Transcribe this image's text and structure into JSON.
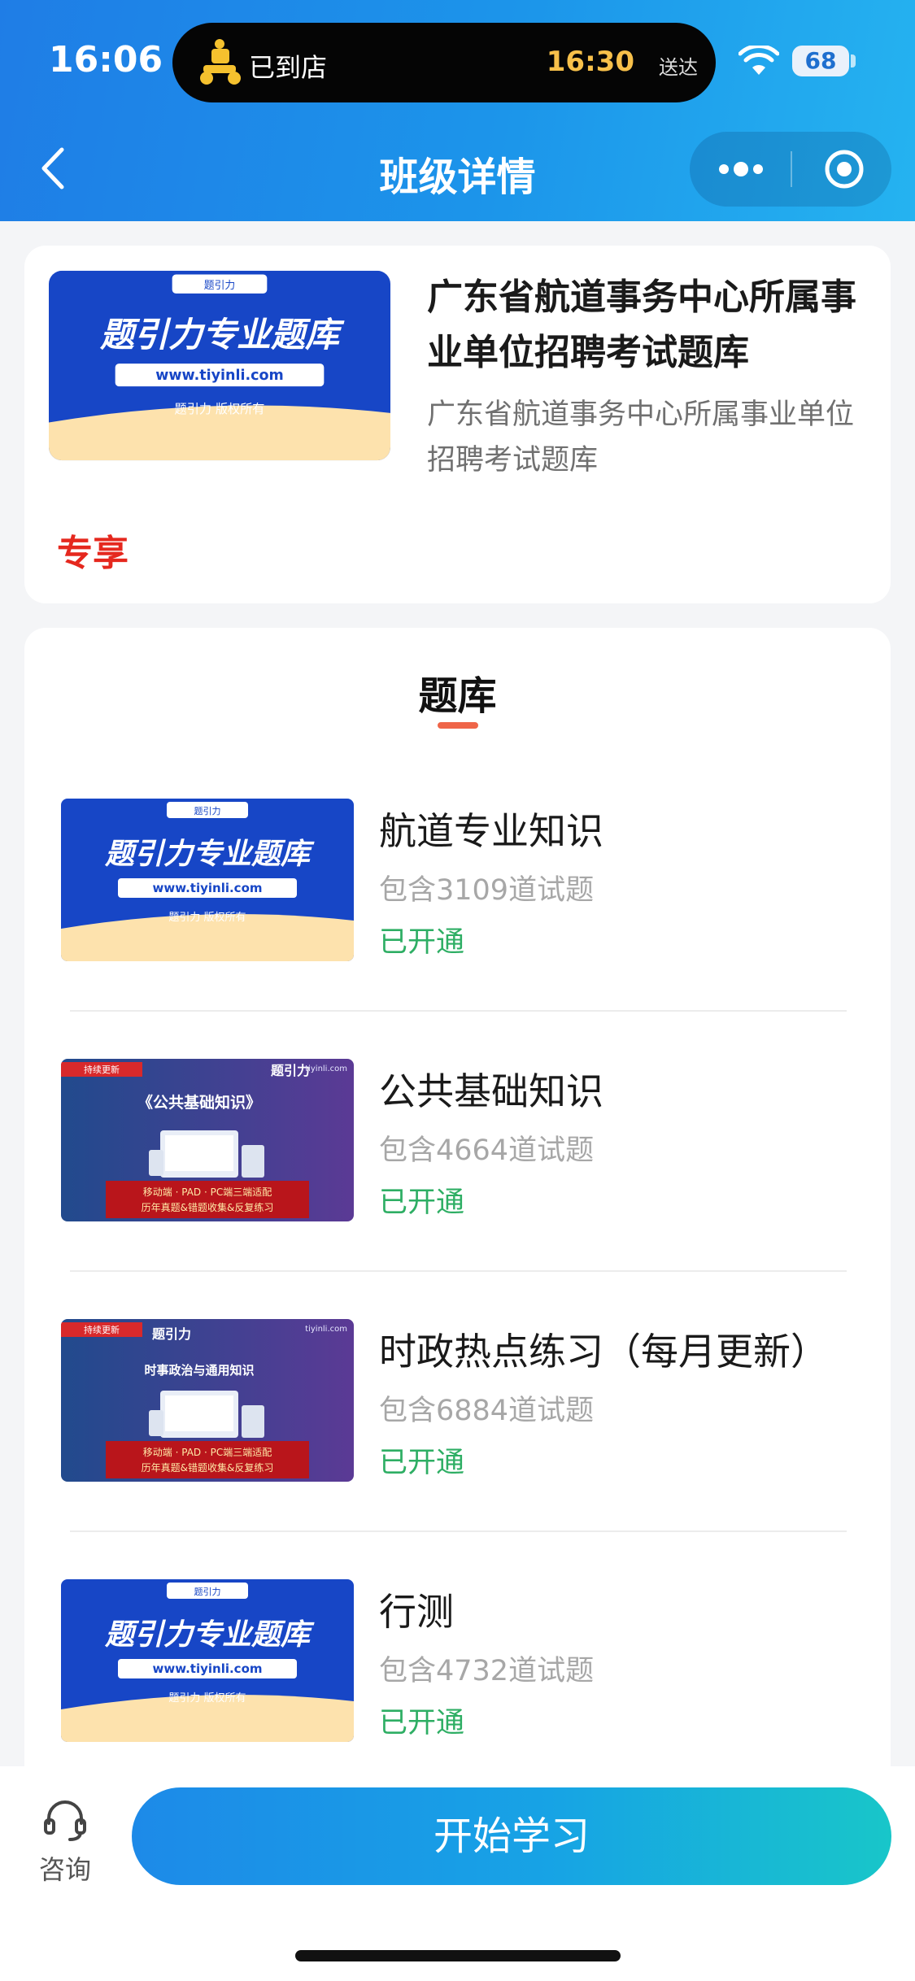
{
  "status_bar": {
    "time": "16:06",
    "live_activity": {
      "status": "已到店",
      "time": "16:30",
      "sub": "送达"
    },
    "battery": "68"
  },
  "nav": {
    "title": "班级详情"
  },
  "course": {
    "title": "广东省航道事务中心所属事业单位招聘考试题库",
    "description": "广东省航道事务中心所属事业单位招聘考试题库",
    "badge": "专享"
  },
  "section": {
    "title": "题库"
  },
  "thumbnails": {
    "brand": {
      "logo_text": "题引力",
      "headline": "题引力专业题库",
      "url": "www.tiyinli.com",
      "footer": "题引力 版权所有"
    },
    "public_basic": {
      "tag": "持续更新",
      "brand": "题引力",
      "site": "tiyinli.com",
      "headline": "《公共基础知识》",
      "line1": "移动端 · PAD · PC端三端适配",
      "line2": "历年真题&错题收集&反复练习"
    },
    "politics": {
      "tag": "持续更新",
      "brand": "题引力",
      "site": "tiyinli.com",
      "headline": "时事政治与通用知识",
      "line1": "移动端 · PAD · PC端三端适配",
      "line2": "历年真题&错题收集&反复练习"
    }
  },
  "banks": [
    {
      "name": "航道专业知识",
      "count": "包含3109道试题",
      "status": "已开通"
    },
    {
      "name": "公共基础知识",
      "count": "包含4664道试题",
      "status": "已开通"
    },
    {
      "name": "时政热点练习（每月更新）",
      "count": "包含6884道试题",
      "status": "已开通"
    },
    {
      "name": "行测",
      "count": "包含4732道试题",
      "status": "已开通"
    }
  ],
  "bottom": {
    "consult_label": "咨询",
    "start_button": "开始学习"
  },
  "colors": {
    "header_start": "#1f7de6",
    "header_end": "#25b3f0",
    "status_opened": "#2eae64",
    "badge_red": "#e5281e",
    "underline": "#ef6548"
  }
}
